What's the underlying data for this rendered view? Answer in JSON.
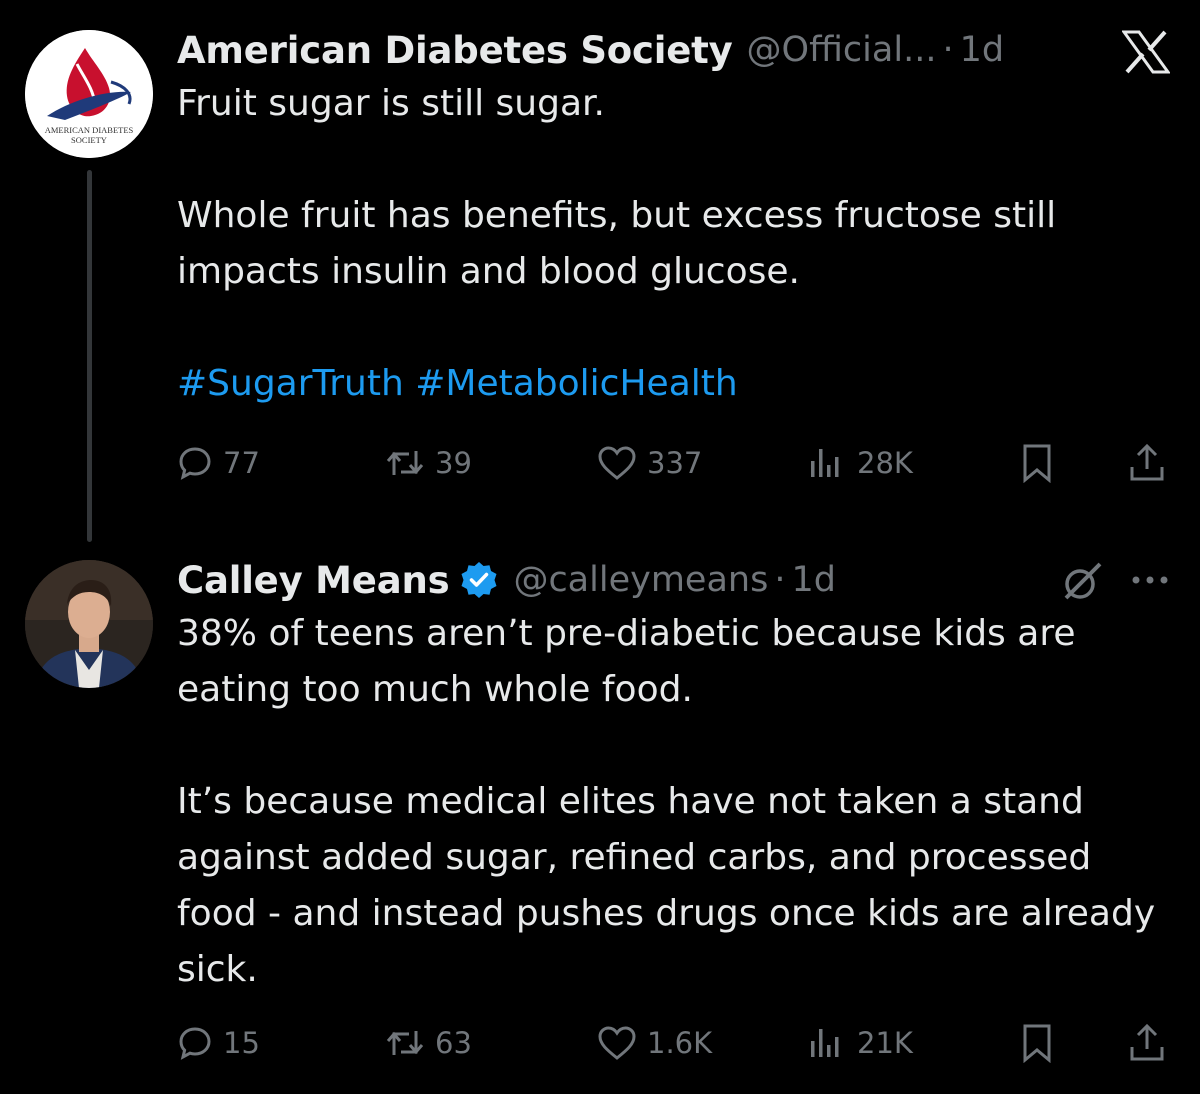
{
  "tweets": [
    {
      "author_name": "American Diabetes Society",
      "handle": "@Official...",
      "separator": "·",
      "time": "1d",
      "avatar_logo_text": "AMERICAN DIABETES SOCIETY",
      "verified": false,
      "paragraphs": [
        "Fruit sugar is still sugar.",
        "Whole fruit has benefits, but excess fructose still impacts insulin and blood glucose."
      ],
      "hashtags": [
        "#SugarTruth",
        "#MetabolicHealth"
      ],
      "stats": {
        "replies": "77",
        "reposts": "39",
        "likes": "337",
        "views": "28K"
      },
      "top_icon": "x-logo-icon"
    },
    {
      "author_name": "Calley Means",
      "handle": "@calleymeans",
      "separator": "·",
      "time": "1d",
      "verified": true,
      "paragraphs": [
        "38% of teens aren’t pre-diabetic because kids are eating too much whole food.",
        "It’s because medical elites have not taken a stand against added sugar, refined carbs, and processed food - and instead pushes drugs once kids are already sick."
      ],
      "stats": {
        "replies": "15",
        "reposts": "63",
        "likes": "1.6K",
        "views": "21K"
      },
      "top_icons": [
        "grok-icon",
        "more-icon"
      ]
    }
  ],
  "colors": {
    "background": "#000000",
    "text": "#e7e9ea",
    "muted": "#71767b",
    "link": "#1d9bf0",
    "verified": "#1d9bf0"
  }
}
